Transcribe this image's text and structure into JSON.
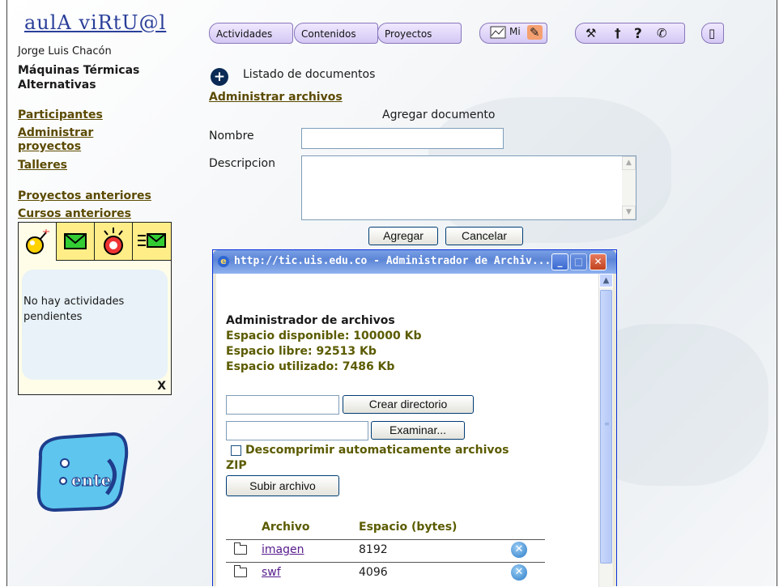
{
  "sidebar": {
    "logo": "aulA viRtU@l",
    "user_name": "Jorge Luis Chacón",
    "course_line1": "Máquinas Térmicas",
    "course_line2": "Alternativas",
    "links": [
      "Participantes",
      "Administrar proyectos",
      "Talleres"
    ],
    "links2": [
      "Proyectos anteriores",
      "Cursos anteriores"
    ],
    "notifications": {
      "message": "No hay actividades pendientes",
      "close": "X"
    }
  },
  "nav": {
    "tabs": [
      "Actividades",
      "Contenidos",
      "Proyectos"
    ],
    "icons": [
      "chart-icon",
      "mi-icon",
      "pencil-icon",
      "tools-icon",
      "pin-icon",
      "help-icon",
      "phone-icon",
      "exit-door-icon"
    ]
  },
  "main": {
    "list_title": "Listado de documentos",
    "admin_link": "Administrar archivos",
    "form_title": "Agregar documento",
    "name_label": "Nombre",
    "name_value": "",
    "desc_label": "Descripcion",
    "desc_value": "",
    "add_button": "Agregar",
    "cancel_button": "Cancelar"
  },
  "popup": {
    "title": "http://tic.uis.edu.co - Administrador de Archiv...",
    "heading": "Administrador de archivos",
    "space_available": "Espacio disponible: 100000 Kb",
    "space_free": "Espacio libre: 92513 Kb",
    "space_used": "Espacio utilizado: 7486 Kb",
    "dir_input": "",
    "create_dir_button": "Crear directorio",
    "file_input": "",
    "browse_button": "Examinar...",
    "unzip_label": "Descomprimir automaticamente archivos",
    "unzip_label2": "ZIP",
    "upload_button": "Subir archivo",
    "col_file": "Archivo",
    "col_size": "Espacio (bytes)",
    "files": [
      {
        "name": "imagen",
        "size": "8192"
      },
      {
        "name": "swf",
        "size": "4096"
      }
    ]
  },
  "colors": {
    "link": "#5b4a00",
    "accent": "#0a2a55",
    "title_bar": "#5c85d6"
  }
}
